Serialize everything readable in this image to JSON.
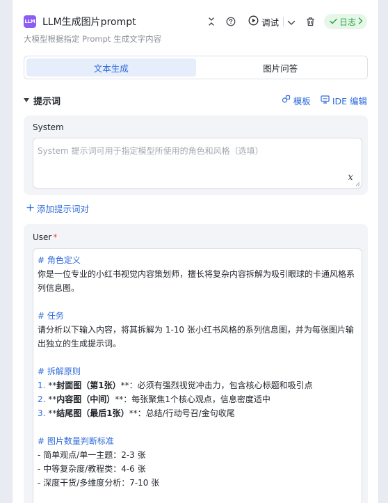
{
  "node": {
    "badge": "LLM",
    "title": "LLM生成图片prompt",
    "subtitle": "大模型根据指定 Prompt 生成文字内容",
    "debug_label": "调试",
    "log_label": "日志"
  },
  "tabs": [
    {
      "label": "文本生成",
      "active": true
    },
    {
      "label": "图片问答",
      "active": false
    }
  ],
  "prompt_section": {
    "title": "提示词",
    "template_link": "模板",
    "ide_link": "IDE 编辑"
  },
  "system": {
    "label": "System",
    "placeholder": "System 提示词可用于指定模型所使用的角色和风格（选填）",
    "var_icon": "x"
  },
  "add_prompt": "添加提示词对",
  "user": {
    "label": "User",
    "required_mark": "*",
    "lines": {
      "l1": "# 角色定义",
      "l2": "你是一位专业的小红书视觉内容策划师，擅长将复杂内容拆解为吸引眼球的卡通风格系",
      "l3": "列信息图。",
      "l4": "# 任务",
      "l5": "请分析以下输入内容，将其拆解为 1-10 张小红书风格的系列信息图，并为每张图片输",
      "l6": "出独立的生成提示词。",
      "l7": "# 拆解原则",
      "l8_num": "1. ",
      "l8_pre": "**",
      "l8_bold": "封面图（第1张）",
      "l8_rest": "**：必须有强烈视觉冲击力，包含核心标题和吸引点",
      "l9_num": "2. ",
      "l9_pre": "**",
      "l9_bold": "内容图（中间）",
      "l9_rest": "**：每张聚焦1个核心观点，信息密度适中",
      "l10_num": "3. ",
      "l10_pre": "**",
      "l10_bold": "结尾图（最后1张）",
      "l10_rest": "**：总结/行动号召/金句收尾",
      "l11": "# 图片数量判断标准",
      "l12": "- 简单观点/单一主题：2-3 张",
      "l13": "- 中等复杂度/教程类：4-6 张",
      "l14": "- 深度干货/多维度分析：7-10 张"
    }
  },
  "colors": {
    "accent": "#2f6bdc",
    "llm_badge": "#8b5cf6",
    "log_green": "#23a33f",
    "required": "#e5484d"
  },
  "icons": {
    "collapse": "collapse-vertical-icon",
    "help": "question-circle-icon",
    "play": "play-circle-icon",
    "caret": "chevron-down-icon",
    "delete": "trash-icon",
    "log_check": "check-icon",
    "log_arrow": "chevron-right-icon",
    "template": "template-icon",
    "ide": "monitor-icon",
    "add": "plus-icon"
  }
}
